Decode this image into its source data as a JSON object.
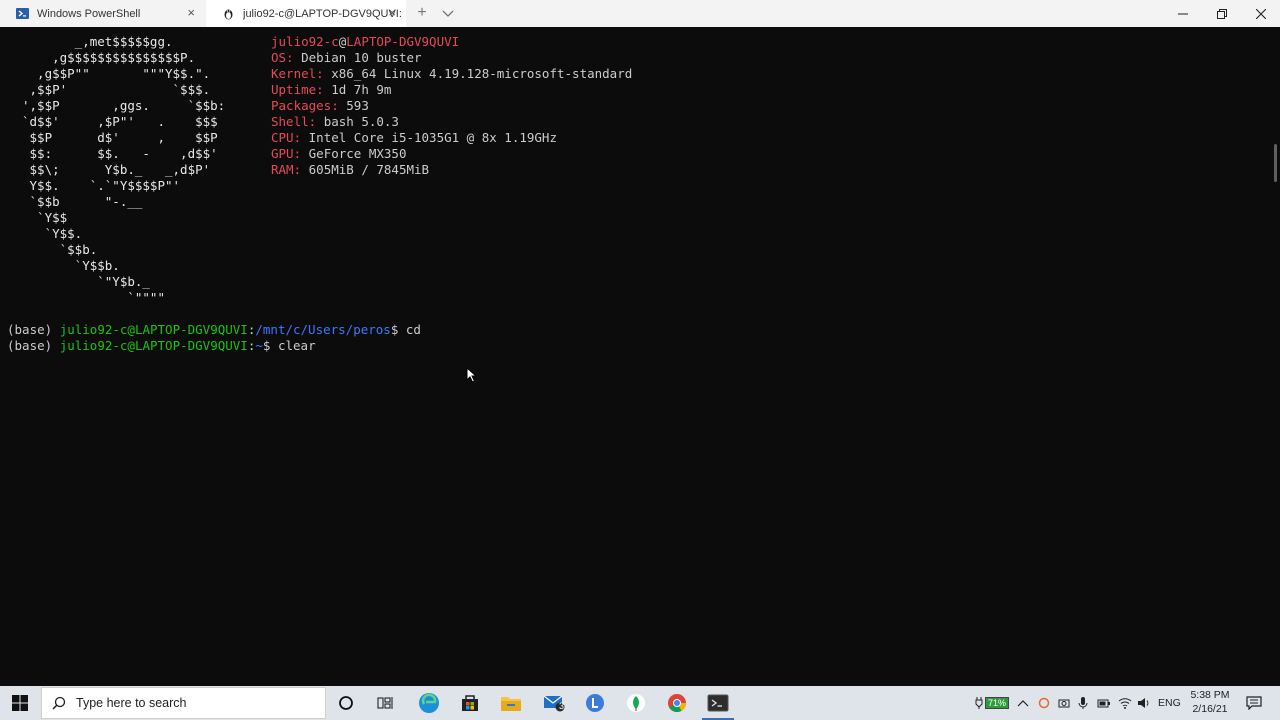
{
  "window": {
    "tabs": [
      {
        "title": "Windows PowerShell",
        "active": false,
        "icon": "powershell-icon"
      },
      {
        "title": "julio92-c@LAPTOP-DGV9QUVI:",
        "active": true,
        "icon": "linux-penguin-icon"
      }
    ],
    "new_tab_label": "+",
    "close_glyph": "×"
  },
  "terminal": {
    "logo_lines": [
      "       _,met$$$$$gg.",
      "    ,g$$$$$$$$$$$$$$$P.",
      "  ,g$$P\"\"       \"\"\"Y$$.\".",
      " ,$$P'              `$$$.",
      "',$$P       ,ggs.     `$$b:",
      "`d$$'     ,$P\"'   .    $$$",
      " $$P      d$'     ,    $$P",
      " $$:      $$.   -    ,d$$'",
      " $$\\;      Y$b._   _,d$P'",
      " Y$$.    `.`\"Y$$$$P\"'",
      " `$$b      \"-.__",
      "  `Y$$",
      "   `Y$$.",
      "     `$$b.",
      "       `Y$$b.",
      "          `\"Y$b._",
      "              `\"\"\"\""
    ],
    "userhost": {
      "user": "julio92-c",
      "at": "@",
      "host": "LAPTOP-DGV9QUVI"
    },
    "info": [
      {
        "key": "OS:",
        "value": "Debian 10 buster"
      },
      {
        "key": "Kernel:",
        "value": "x86_64 Linux 4.19.128-microsoft-standard"
      },
      {
        "key": "Uptime:",
        "value": "1d 7h 9m"
      },
      {
        "key": "Packages:",
        "value": "593"
      },
      {
        "key": "Shell:",
        "value": "bash 5.0.3"
      },
      {
        "key": "CPU:",
        "value": "Intel Core i5-1035G1 @ 8x 1.19GHz"
      },
      {
        "key": "GPU:",
        "value": "GeForce MX350"
      },
      {
        "key": "RAM:",
        "value": "605MiB / 7845MiB"
      }
    ],
    "prompts": [
      {
        "env": "(base)",
        "userhost": "julio92-c@LAPTOP-DGV9QUVI",
        "sep": ":",
        "path": "/mnt/c/Users/peros",
        "symbol": "$",
        "command": "cd"
      },
      {
        "env": "(base)",
        "userhost": "julio92-c@LAPTOP-DGV9QUVI",
        "sep": ":",
        "path": "~",
        "symbol": "$",
        "command": "clear"
      }
    ]
  },
  "taskbar": {
    "search_placeholder": "Type here to search",
    "apps": [
      "cortana-circle-icon",
      "task-view-icon",
      "edge-icon",
      "store-icon",
      "file-explorer-icon",
      "mail-icon",
      "l-app-icon",
      "mongodb-leaf-icon",
      "chrome-icon",
      "terminal-icon"
    ],
    "mail_badge": "3",
    "battery": "71%",
    "language": "ENG",
    "time": "5:38 PM",
    "date": "2/16/21"
  },
  "colors": {
    "terminal_bg": "#0c0c0c",
    "info_key": "#e74856",
    "prompt_green": "#16c60c",
    "path_blue": "#3b78ff"
  }
}
